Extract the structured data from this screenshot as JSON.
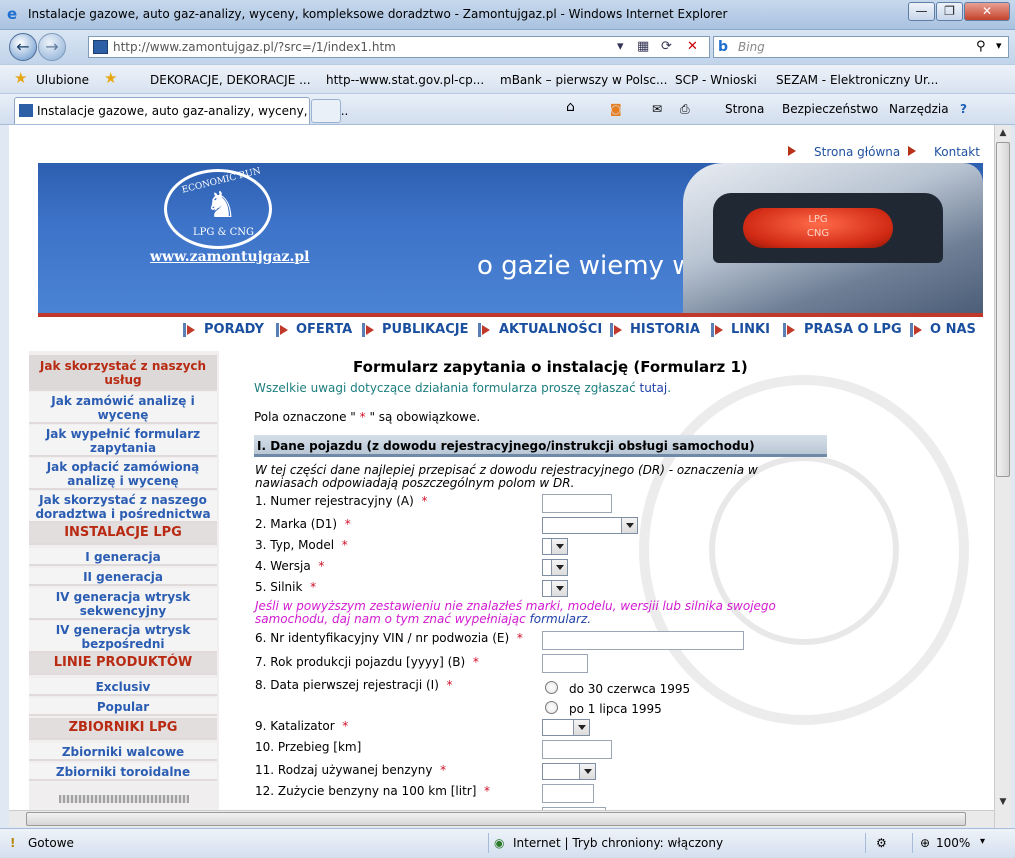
{
  "window": {
    "title": "Instalacje gazowe, auto gaz-analizy, wyceny, kompleksowe doradztwo - Zamontujgaz.pl - Windows Internet Explorer",
    "minimize": "—",
    "maximize": "❐",
    "close": "✕"
  },
  "address": {
    "url": "http://www.zamontujgaz.pl/?src=/1/index1.htm",
    "search_placeholder": "Bing"
  },
  "favorites": {
    "label": "Ulubione",
    "items": [
      "DEKORACJE, DEKORACJE ...",
      "http--www.stat.gov.pl-cp...",
      "mBank – pierwszy w Polsc...",
      "SCP - Wnioski",
      "SEZAM - Elektroniczny Ur..."
    ]
  },
  "tab": {
    "title": "Instalacje gazowe, auto gaz-analizy, wyceny, kom..."
  },
  "commands": {
    "strona": "Strona",
    "bezpieczenstwo": "Bezpieczeństwo",
    "narzedzia": "Narzędzia"
  },
  "page": {
    "toplinks": {
      "home": "Strona główna",
      "contact": "Kontakt"
    },
    "banner": {
      "slogan": "o gazie wiemy wszystko",
      "site": "www.zamontujgaz.pl",
      "logo_top": "ECONOMIC RUN",
      "logo_bottom": "LPG & CNG",
      "tank_lpg": "LPG",
      "tank_cng": "CNG"
    },
    "nav": [
      "PORADY",
      "OFERTA",
      "PUBLIKACJE",
      "AKTUALNOŚCI",
      "HISTORIA",
      "LINKI",
      "PRASA O LPG",
      "O NAS"
    ],
    "sidebar": {
      "items": [
        {
          "label": "Jak skorzystać z naszych usług"
        },
        {
          "label": "Jak zamówić analizę i wycenę"
        },
        {
          "label": "Jak wypełnić formularz zapytania"
        },
        {
          "label": "Jak opłacić zamówioną analizę i wycenę"
        },
        {
          "label": "Jak skorzystać z naszego doradztwa i pośrednictwa"
        }
      ],
      "h_instalacje": "INSTALACJE LPG",
      "instalacje": [
        "I generacja",
        "II generacja",
        "IV generacja wtrysk sekwencyjny",
        "IV generacja wtrysk bezpośredni"
      ],
      "h_linie": "LINIE PRODUKTÓW",
      "linie": [
        "Exclusiv",
        "Popular"
      ],
      "h_zbiorniki": "ZBIORNIKI LPG",
      "zbiorniki": [
        "Zbiorniki walcowe",
        "Zbiorniki toroidalne"
      ]
    },
    "form": {
      "title": "Formularz zapytania o instalację (Formularz 1)",
      "remarks": "Wszelkie uwagi dotyczące działania formularza proszę zgłaszać",
      "remarks_link": "tutaj",
      "remarks_end": ".",
      "required_pre": "Pola oznaczone \" ",
      "required_star": "*",
      "required_post": " \" są obowiązkowe.",
      "section1": "I. Dane pojazdu (z dowodu rejestracyjnego/instrukcji obsługi samochodu)",
      "section1_note": "W tej części dane najlepiej przepisać z dowodu rejestracyjnego (DR) - oznaczenia w nawiasach odpowiadają poszczególnym polom w DR.",
      "star": "*",
      "fields": {
        "f1": "1. Numer rejestracyjny (A)",
        "f2": "2. Marka (D1)",
        "f3": "3. Typ, Model",
        "f4": "4. Wersja",
        "f5": "5. Silnik",
        "f6": "6. Nr identyfikacyjny VIN / nr podwozia (E)",
        "f7": "7. Rok produkcji pojazdu [yyyy] (B)",
        "f8": "8. Data pierwszej rejestracji (I)",
        "f9": "9. Katalizator",
        "f10": "10. Przebieg [km]",
        "f11": "11. Rodzaj używanej benzyny",
        "f12": "12. Zużycie benzyny na 100 km [litr]"
      },
      "missing_note": "Jeśli w powyższym zestawieniu nie znalazłeś marki, modelu, wersjii lub silnika swojego samochodu, daj nam o tym znać wypełniając",
      "missing_link": "formularz",
      "date_opt1": "do 30 czerwca 1995",
      "date_opt2": "po 1 lipca 1995"
    }
  },
  "status": {
    "text": "Gotowe",
    "zone": "Internet | Tryb chroniony: włączony",
    "zoom": "100%"
  }
}
